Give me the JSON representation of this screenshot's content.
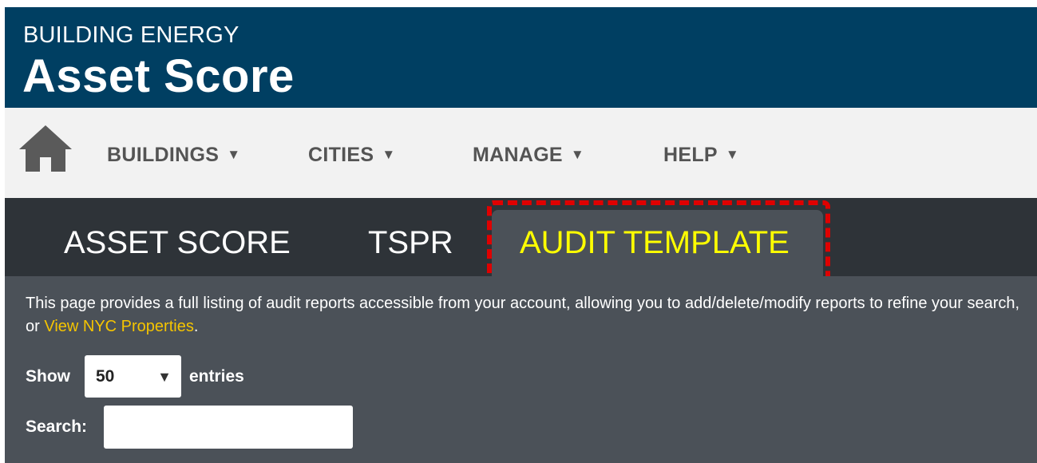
{
  "header": {
    "subtitle": "BUILDING ENERGY",
    "title": "Asset Score"
  },
  "main_nav": {
    "home_icon": "home-icon",
    "items": [
      {
        "label": "BUILDINGS",
        "caret": "▼"
      },
      {
        "label": "CITIES",
        "caret": "▼"
      },
      {
        "label": "MANAGE",
        "caret": "▼"
      },
      {
        "label": "HELP",
        "caret": "▼"
      }
    ]
  },
  "sub_nav": {
    "tabs": [
      {
        "label": "ASSET SCORE",
        "active": false
      },
      {
        "label": "TSPR",
        "active": false
      },
      {
        "label": "AUDIT TEMPLATE",
        "active": true
      }
    ],
    "highlight_color": "#e00000"
  },
  "content": {
    "intro_text": "This page provides a full listing of audit reports accessible from your account, allowing you to add/delete/modify reports to refine your search, or ",
    "intro_link": "View NYC Properties",
    "intro_end": ".",
    "show_label": "Show",
    "entries_select_value": "50",
    "entries_label": "entries",
    "search_label": "Search:",
    "search_value": ""
  },
  "colors": {
    "header_bg": "#003f62",
    "nav_bg": "#f2f2f2",
    "subnav_bg": "#2e3338",
    "content_bg": "#4b5158",
    "active_tab_text": "#ffff00",
    "link": "#f5c400"
  }
}
